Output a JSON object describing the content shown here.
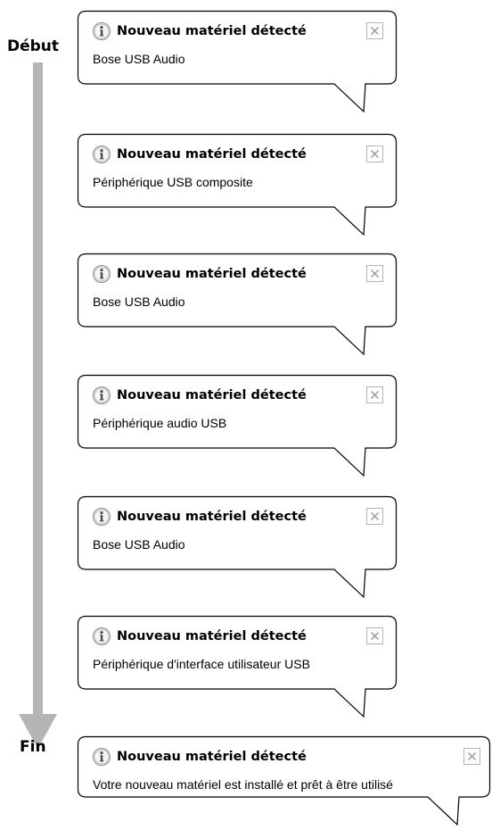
{
  "timeline": {
    "start_label": "Début",
    "end_label": "Fin"
  },
  "icon": "info-icon",
  "notifications": [
    {
      "title": "Nouveau matériel détecté",
      "message": "Bose USB Audio"
    },
    {
      "title": "Nouveau matériel détecté",
      "message": "Périphérique USB composite"
    },
    {
      "title": "Nouveau matériel détecté",
      "message": "Bose USB Audio"
    },
    {
      "title": "Nouveau matériel détecté",
      "message": "Périphérique audio USB"
    },
    {
      "title": "Nouveau matériel détecté",
      "message": "Bose USB Audio"
    },
    {
      "title": "Nouveau matériel détecté",
      "message": "Périphérique d'interface utilisateur USB"
    },
    {
      "title": "Nouveau matériel détecté",
      "message": "Votre nouveau matériel est installé et prêt à être utilisé"
    }
  ]
}
